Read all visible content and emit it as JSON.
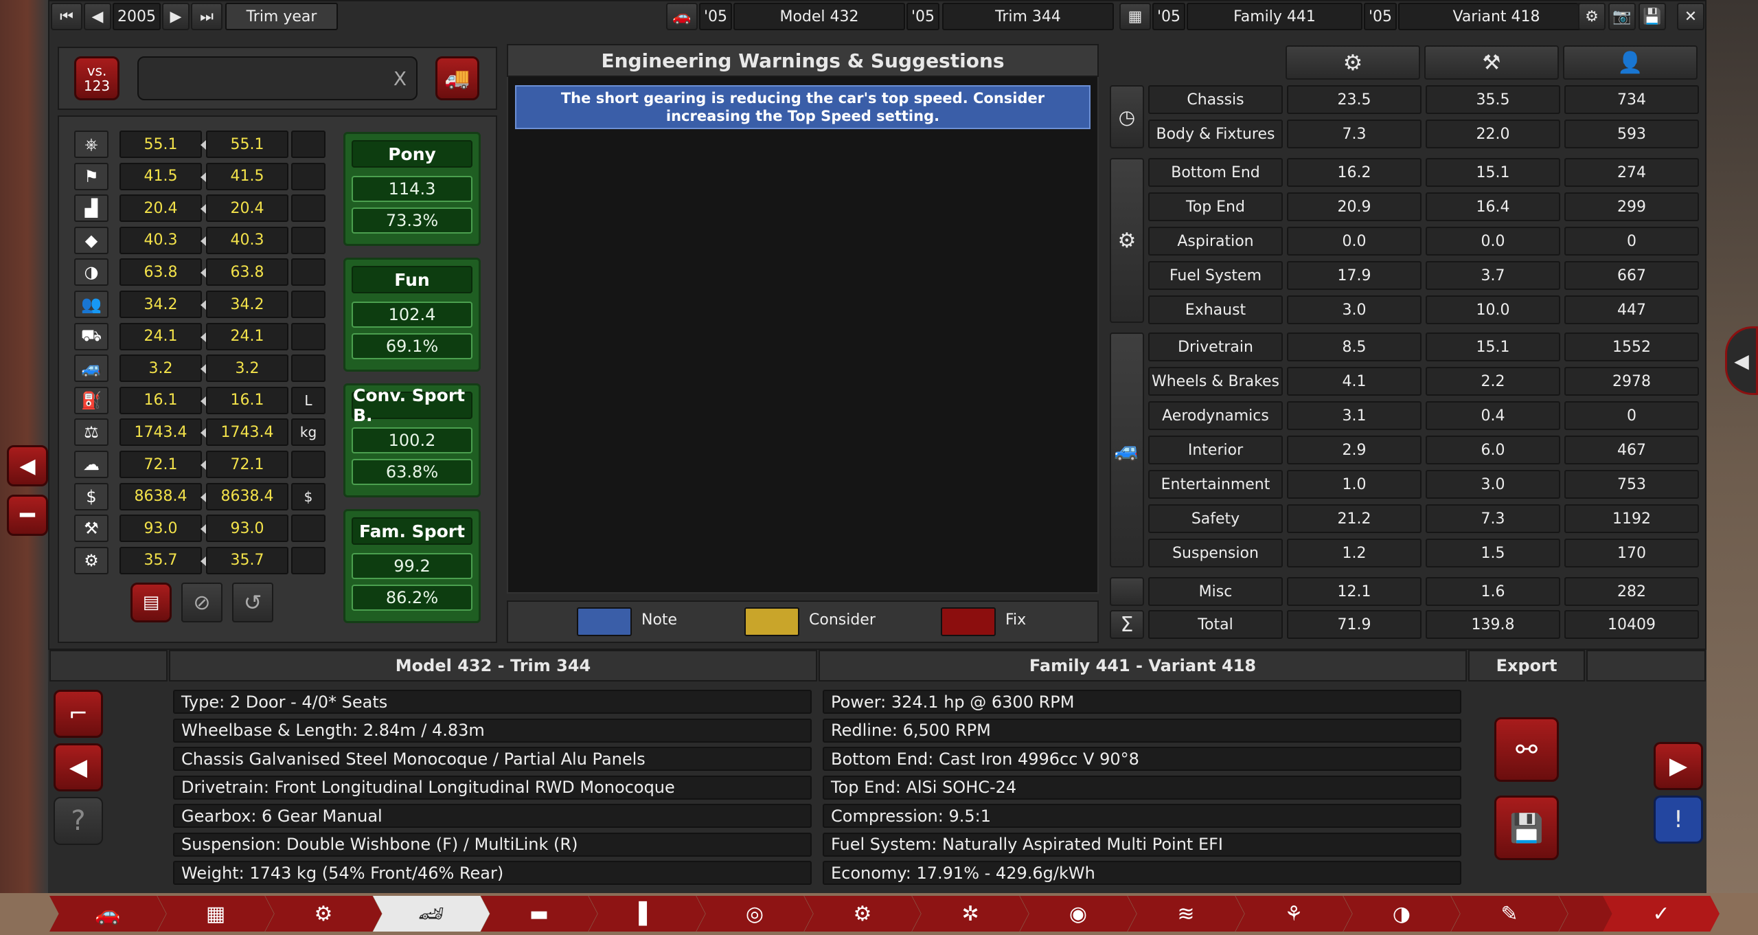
{
  "topbar": {
    "year": "2005",
    "trim_year_label": "Trim year",
    "model_year": "'05",
    "model": "Model 432",
    "trim_year": "'05",
    "trim": "Trim 344",
    "family_year": "'05",
    "family": "Family 441",
    "variant_year": "'05",
    "variant": "Variant 418"
  },
  "compare": {
    "vs_label": "vs.",
    "vs_num": "123",
    "search_value": "",
    "clear": "X"
  },
  "stats": [
    {
      "icon": "steering-wheel",
      "a": "55.1",
      "b": "55.1",
      "unit": ""
    },
    {
      "icon": "checkered-flag",
      "a": "41.5",
      "b": "41.5",
      "unit": ""
    },
    {
      "icon": "seat",
      "a": "20.4",
      "b": "20.4",
      "unit": ""
    },
    {
      "icon": "diamond",
      "a": "40.3",
      "b": "40.3",
      "unit": ""
    },
    {
      "icon": "safety-wheel",
      "a": "63.8",
      "b": "63.8",
      "unit": ""
    },
    {
      "icon": "people",
      "a": "34.2",
      "b": "34.2",
      "unit": ""
    },
    {
      "icon": "utility-truck",
      "a": "24.1",
      "b": "24.1",
      "unit": ""
    },
    {
      "icon": "offroad-car",
      "a": "3.2",
      "b": "3.2",
      "unit": ""
    },
    {
      "icon": "fuel-can",
      "a": "16.1",
      "b": "16.1",
      "unit": "L"
    },
    {
      "icon": "weight",
      "a": "1743.4",
      "b": "1743.4",
      "unit": "kg"
    },
    {
      "icon": "environment",
      "a": "72.1",
      "b": "72.1",
      "unit": ""
    },
    {
      "icon": "cost",
      "a": "8638.4",
      "b": "8638.4",
      "unit": "$"
    },
    {
      "icon": "anvil",
      "a": "93.0",
      "b": "93.0",
      "unit": ""
    },
    {
      "icon": "gear-wrench",
      "a": "35.7",
      "b": "35.7",
      "unit": ""
    }
  ],
  "markets": [
    {
      "name": "Pony",
      "score": "114.3",
      "pct": "73.3%"
    },
    {
      "name": "Fun",
      "score": "102.4",
      "pct": "69.1%"
    },
    {
      "name": "Conv. Sport B.",
      "score": "100.2",
      "pct": "63.8%"
    },
    {
      "name": "Fam. Sport",
      "score": "99.2",
      "pct": "86.2%"
    }
  ],
  "warnings": {
    "title": "Engineering Warnings & Suggestions",
    "items": [
      "The short gearing is reducing the car's top speed. Consider increasing the Top Speed setting."
    ],
    "legend": [
      {
        "label": "Note",
        "color": "#3a5ea8"
      },
      {
        "label": "Consider",
        "color": "#c9a52a"
      },
      {
        "label": "Fix",
        "color": "#8c0e0e"
      }
    ]
  },
  "breakdown": {
    "rows": [
      {
        "name": "Chassis",
        "a": "23.5",
        "b": "35.5",
        "c": "734"
      },
      {
        "name": "Body & Fixtures",
        "a": "7.3",
        "b": "22.0",
        "c": "593"
      },
      {
        "name": "Bottom End",
        "a": "16.2",
        "b": "15.1",
        "c": "274"
      },
      {
        "name": "Top End",
        "a": "20.9",
        "b": "16.4",
        "c": "299"
      },
      {
        "name": "Aspiration",
        "a": "0.0",
        "b": "0.0",
        "c": "0"
      },
      {
        "name": "Fuel System",
        "a": "17.9",
        "b": "3.7",
        "c": "667"
      },
      {
        "name": "Exhaust",
        "a": "3.0",
        "b": "10.0",
        "c": "447"
      },
      {
        "name": "Drivetrain",
        "a": "8.5",
        "b": "15.1",
        "c": "1552"
      },
      {
        "name": "Wheels & Brakes",
        "a": "4.1",
        "b": "2.2",
        "c": "2978"
      },
      {
        "name": "Aerodynamics",
        "a": "3.1",
        "b": "0.4",
        "c": "0"
      },
      {
        "name": "Interior",
        "a": "2.9",
        "b": "6.0",
        "c": "467"
      },
      {
        "name": "Entertainment",
        "a": "1.0",
        "b": "3.0",
        "c": "753"
      },
      {
        "name": "Safety",
        "a": "21.2",
        "b": "7.3",
        "c": "1192"
      },
      {
        "name": "Suspension",
        "a": "1.2",
        "b": "1.5",
        "c": "170"
      },
      {
        "name": "Misc",
        "a": "12.1",
        "b": "1.6",
        "c": "282"
      },
      {
        "name": "Total",
        "a": "71.9",
        "b": "139.8",
        "c": "10409"
      }
    ]
  },
  "summary": {
    "left_title": "Model 432 - Trim 344",
    "right_title": "Family 441 - Variant 418",
    "export": "Export",
    "left": [
      "Type: 2 Door - 4/0* Seats",
      "Wheelbase & Length: 2.84m / 4.83m",
      "Chassis Galvanised Steel Monocoque / Partial Alu Panels",
      "Drivetrain: Front Longitudinal Longitudinal RWD Monocoque",
      "Gearbox: 6 Gear Manual",
      "Suspension: Double Wishbone (F) / MultiLink (R)",
      "Weight: 1743 kg (54% Front/46% Rear)"
    ],
    "right": [
      "Power: 324.1 hp @ 6300 RPM",
      "Redline:  6,500 RPM",
      "Bottom End: Cast Iron 4996cc V 90°8",
      "Top End: AlSi SOHC-24",
      "Compression: 9.5:1",
      "Fuel System: Naturally Aspirated Multi Point EFI",
      "Economy: 17.91% - 429.6g/kWh"
    ]
  },
  "icons": {
    "first": "⏮",
    "prev": "◀",
    "next": "▶",
    "last": "⏭",
    "check": "✓",
    "sigma": "Σ"
  }
}
